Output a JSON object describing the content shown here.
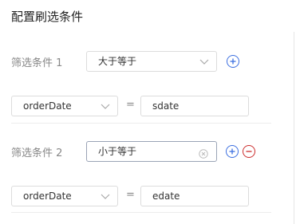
{
  "panel": {
    "title": "配置刷选条件"
  },
  "conditions": [
    {
      "label": "筛选条件 1",
      "operator": "大于等于",
      "field": "orderDate",
      "equals": "=",
      "value": "sdate"
    },
    {
      "label": "筛选条件 2",
      "operator": "小于等于",
      "field": "orderDate",
      "equals": "=",
      "value": "edate"
    }
  ],
  "colors": {
    "accent": "#3c6fe0",
    "danger": "#cc2d2d",
    "border": "#dcdcdc"
  }
}
